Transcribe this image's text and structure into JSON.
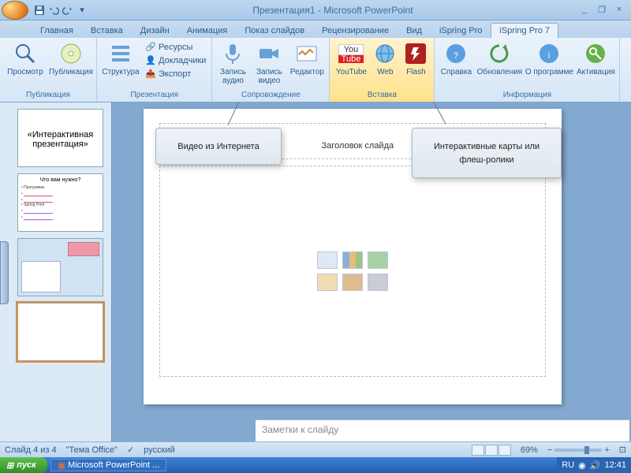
{
  "window": {
    "title": "Презентация1 - Microsoft PowerPoint"
  },
  "tabs": {
    "home": "Главная",
    "insert": "Вставка",
    "design": "Дизайн",
    "animation": "Анимация",
    "slideshow": "Показ слайдов",
    "review": "Рецензирование",
    "view": "Вид",
    "ispring": "iSpring Pro",
    "ispring7": "iSpring Pro 7"
  },
  "ribbon": {
    "publish": {
      "preview": "Просмотр",
      "publish": "Публикация",
      "group": "Публикация"
    },
    "presentation_group": "Презентация",
    "structure": "Структура",
    "resources": "Ресурсы",
    "presenters": "Докладчики",
    "export": "Экспорт",
    "narration_group": "Сопровождение",
    "rec_audio": "Запись аудио",
    "rec_video": "Запись видео",
    "editor": "Редактор",
    "insert_group": "Вставка",
    "youtube": "YouTube",
    "web": "Web",
    "flash": "Flash",
    "info_group": "Информация",
    "help": "Справка",
    "updates": "Обновления",
    "about": "О программе",
    "activation": "Активация"
  },
  "callouts": {
    "left": "Видео из Интернета",
    "right": "Интерактивные карты или флеш-ролики"
  },
  "slide": {
    "title_placeholder": "Заголовок слайда"
  },
  "thumbs": {
    "t1": "«Интерактивная презентация»",
    "t2_title": "Что вам нужно?"
  },
  "notes_placeholder": "Заметки к слайду",
  "status": {
    "slide_of": "Слайд 4 из 4",
    "theme": "\"Тема Office\"",
    "lang": "русский",
    "zoom": "69%"
  },
  "taskbar": {
    "start": "пуск",
    "app": "Microsoft PowerPoint ...",
    "lang": "RU",
    "time": "12:41"
  }
}
